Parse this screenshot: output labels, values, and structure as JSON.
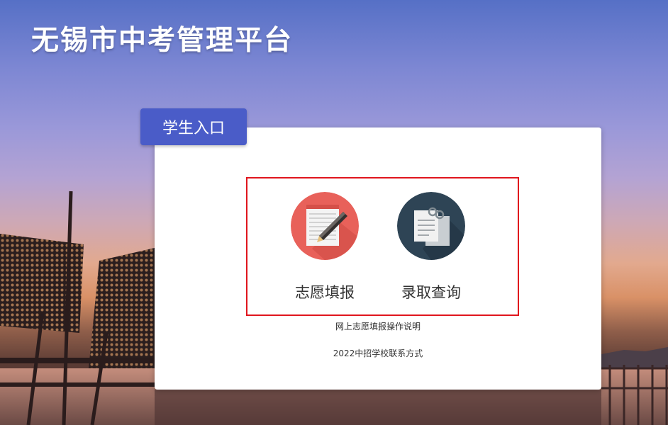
{
  "header": {
    "title": "无锡市中考管理平台"
  },
  "tab": {
    "label": "学生入口"
  },
  "entries": [
    {
      "label": "志愿填报",
      "icon": "pen-notepad-icon",
      "color": "#e8615a"
    },
    {
      "label": "录取查询",
      "icon": "clipped-papers-icon",
      "color": "#2e4455"
    }
  ],
  "links": [
    {
      "label": "网上志愿填报操作说明"
    },
    {
      "label": "2022中招学校联系方式"
    }
  ],
  "colors": {
    "tab": "#4a5cc8",
    "highlight_border": "#e0151d"
  }
}
